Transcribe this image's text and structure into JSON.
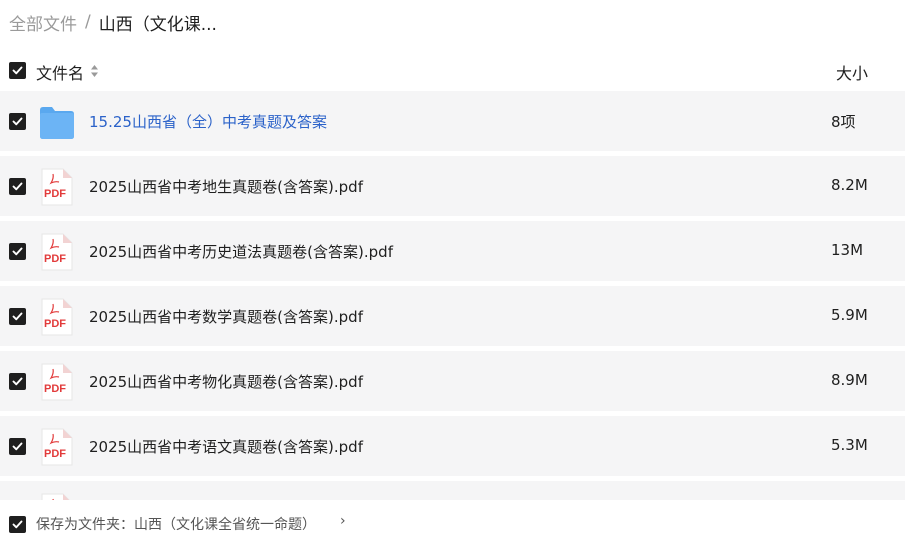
{
  "breadcrumb": {
    "root": "全部文件",
    "separator": "/",
    "current": "山西（文化课..."
  },
  "header": {
    "name_label": "文件名",
    "size_label": "大小"
  },
  "files": [
    {
      "type": "folder",
      "name": "15.25山西省（全）中考真题及答案",
      "size": "8项"
    },
    {
      "type": "pdf",
      "icon_text": "PDF",
      "name": "2025山西省中考地生真题卷(含答案).pdf",
      "size": "8.2M"
    },
    {
      "type": "pdf",
      "icon_text": "PDF",
      "name": "2025山西省中考历史道法真题卷(含答案).pdf",
      "size": "13M"
    },
    {
      "type": "pdf",
      "icon_text": "PDF",
      "name": "2025山西省中考数学真题卷(含答案).pdf",
      "size": "5.9M"
    },
    {
      "type": "pdf",
      "icon_text": "PDF",
      "name": "2025山西省中考物化真题卷(含答案).pdf",
      "size": "8.9M"
    },
    {
      "type": "pdf",
      "icon_text": "PDF",
      "name": "2025山西省中考语文真题卷(含答案).pdf",
      "size": "5.3M"
    }
  ],
  "footer": {
    "save_label": "保存为文件夹：山西（文化课全省统一命题）",
    "chevron": "›"
  },
  "colors": {
    "row_bg": "#f5f5f6",
    "folder_blue": "#6cb4f5",
    "folder_link": "#2b62c9",
    "pdf_red": "#e23b3b",
    "checkbox": "#1f1f1f"
  }
}
